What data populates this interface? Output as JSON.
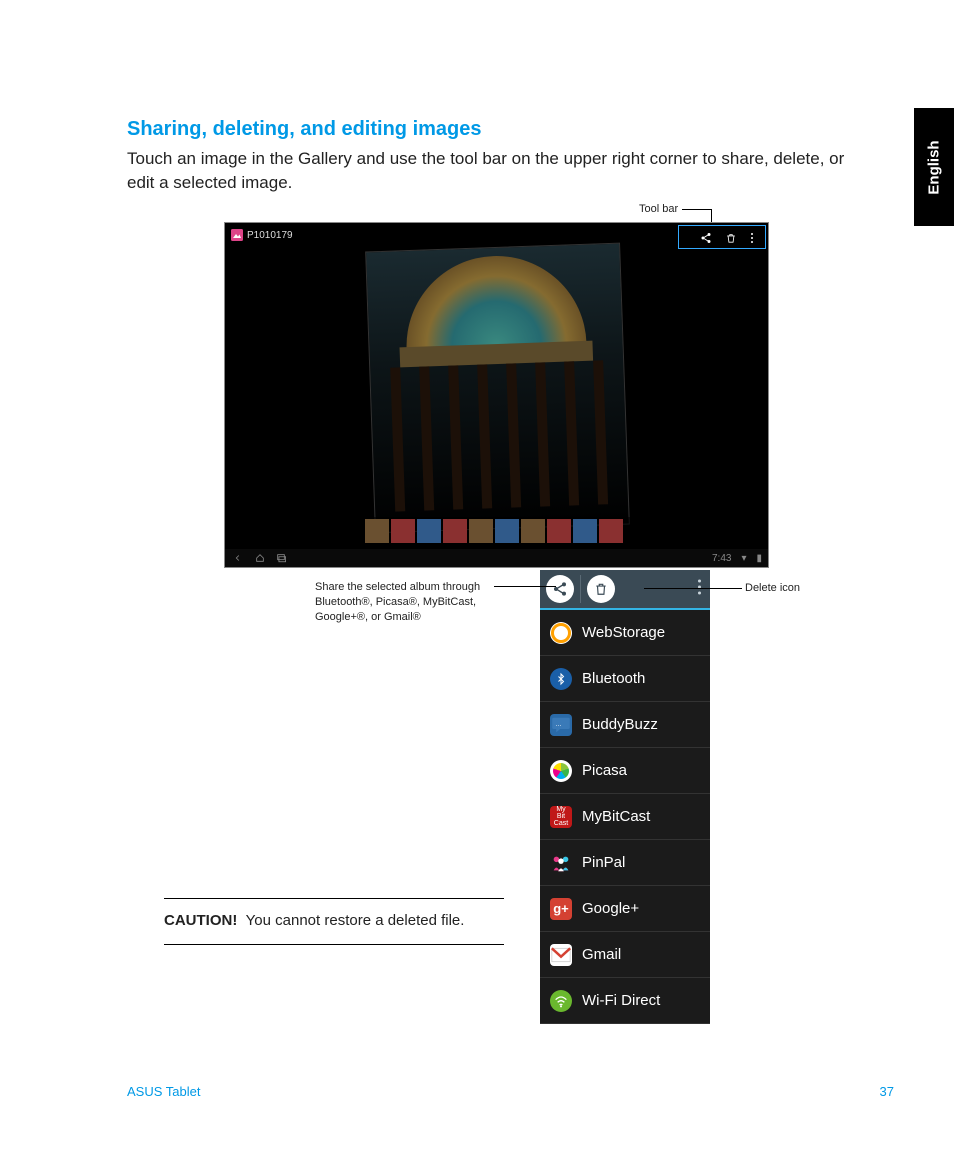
{
  "language_tab": "English",
  "section": {
    "title": "Sharing, deleting, and editing images",
    "body": "Touch an image in the Gallery and use the tool bar on the upper right corner to share, delete, or edit a selected image."
  },
  "callouts": {
    "toolbar": "Tool bar",
    "share": "Share the selected album through Bluetooth®, Picasa®, MyBitCast, Google+®, or Gmail®",
    "delete": "Delete icon"
  },
  "gallery": {
    "image_title": "P1010179",
    "status_time": "7:43",
    "toolbar_icons": [
      "share-icon",
      "trash-icon",
      "overflow-icon"
    ]
  },
  "share_menu": {
    "header_icons": [
      "share-icon",
      "trash-icon",
      "overflow-icon"
    ],
    "items": [
      {
        "icon": "webstorage-icon",
        "label": "WebStorage"
      },
      {
        "icon": "bluetooth-icon",
        "label": "Bluetooth"
      },
      {
        "icon": "buddybuzz-icon",
        "label": "BuddyBuzz"
      },
      {
        "icon": "picasa-icon",
        "label": "Picasa"
      },
      {
        "icon": "mybitcast-icon",
        "label": "MyBitCast"
      },
      {
        "icon": "pinpal-icon",
        "label": "PinPal"
      },
      {
        "icon": "googleplus-icon",
        "label": "Google+"
      },
      {
        "icon": "gmail-icon",
        "label": "Gmail"
      },
      {
        "icon": "wifidirect-icon",
        "label": "Wi-Fi Direct"
      }
    ]
  },
  "caution": {
    "label": "CAUTION!",
    "text": "You cannot restore a deleted file."
  },
  "footer": {
    "left": "ASUS Tablet",
    "page": "37"
  }
}
